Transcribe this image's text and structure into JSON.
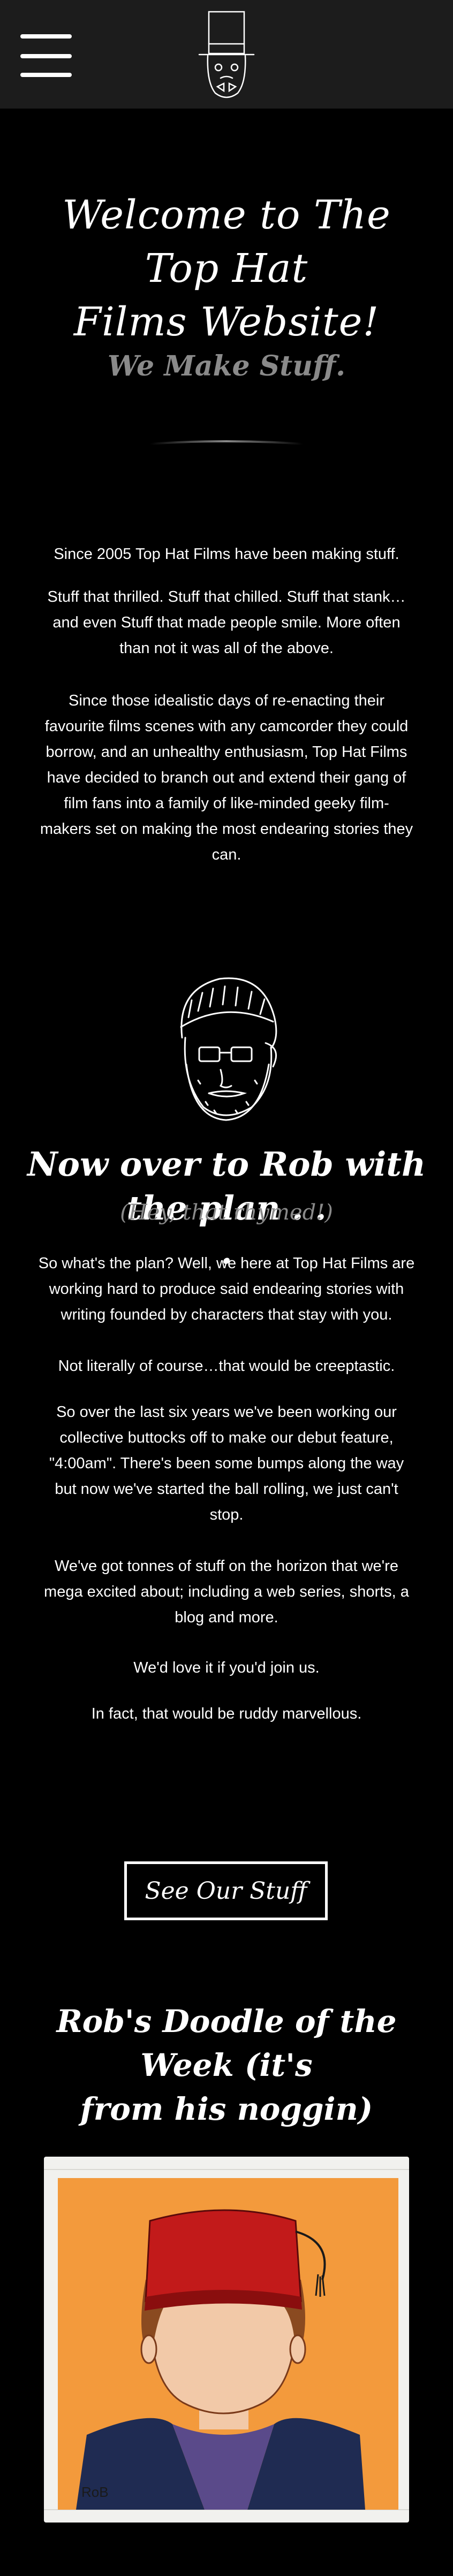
{
  "header": {
    "menu_icon": "hamburger-menu-icon",
    "logo_icon": "top-hat-logo-icon"
  },
  "hero": {
    "title_line1": "Welcome to The Top Hat",
    "title_line2": "Films Website!",
    "subtitle": "We Make Stuff."
  },
  "intro": {
    "p1": "Since 2005 Top Hat Films have been making stuff.",
    "p2_l1": "Stuff that thrilled. Stuff that chilled. Stuff that stank…",
    "p2_l2": "and even Stuff that made people smile. More often",
    "p2_l3": "than not it was all of the above.",
    "p3_l1": "Since those idealistic days of re-enacting their",
    "p3_l2": "favourite films scenes with any camcorder they could",
    "p3_l3": "borrow, and an unhealthy enthusiasm, Top Hat Films",
    "p3_l4": "have decided to branch out and extend their gang of",
    "p3_l5": "film fans into a family of like-minded geeky film-",
    "p3_l6": "makers set on making the most endearing stories they",
    "p3_l7": "can."
  },
  "plan": {
    "title_l1": "Now over to Rob with the plan . .",
    "title_l2": ".",
    "aside": "(Hey, that rhymed!)",
    "p1_l1": "So what's the plan? Well, we here at Top Hat Films are",
    "p1_l2": "working hard to produce said endearing stories with",
    "p1_l3": "writing founded by characters that stay with you.",
    "p2": "Not literally of course…that would be creeptastic.",
    "p3_l1": "So over the last six years we've been working our",
    "p3_l2": "collective buttocks off to make our debut feature,",
    "p3_l3": "\"4:00am\". There's been some bumps along the way",
    "p3_l4": "but now we've started the ball rolling, we just can't",
    "p3_l5": "stop.",
    "p4_l1": "We've got tonnes of stuff on the horizon that we're",
    "p4_l2": "mega excited about; including a web series, shorts, a",
    "p4_l3": "blog and more.",
    "p5": "We'd love it if you'd join us.",
    "p6": "In fact, that would be ruddy marvellous."
  },
  "cta": {
    "label": "See Our Stuff"
  },
  "doodle": {
    "title_l1": "Rob's Doodle of the Week (it's",
    "title_l2": "from his noggin)",
    "signature": "RoB"
  }
}
